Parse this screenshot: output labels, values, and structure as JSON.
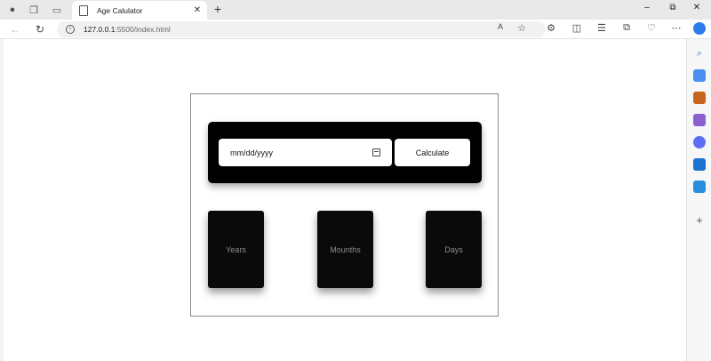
{
  "browser": {
    "tab_title": "Age Calulator",
    "new_tab_symbol": "+",
    "tab_close_symbol": "✕",
    "url_host": "127.0.0.1",
    "url_rest": ":5500/index.html",
    "window_controls": [
      "–",
      "⧉",
      "✕"
    ]
  },
  "app": {
    "date_placeholder": "mm/dd/yyyy",
    "calculate_label": "Calculate",
    "results": [
      {
        "label": "Years"
      },
      {
        "label": "Mounths"
      },
      {
        "label": "Days"
      }
    ]
  },
  "icons": {
    "sidebar": [
      "copilot-icon",
      "search-icon",
      "shopping-tag-icon",
      "toolbox-icon",
      "games-icon",
      "office-icon",
      "outlook-icon",
      "send-icon",
      "add-icon"
    ],
    "colors": {
      "copilot": "#2b7de9",
      "search": "#3a6fd8",
      "tag": "#4a8ff0",
      "toolbox": "#c8641e",
      "games": "#8a5fd0",
      "office": "#5b6ef5",
      "outlook": "#1a73d0",
      "send": "#2a8ee0"
    }
  }
}
